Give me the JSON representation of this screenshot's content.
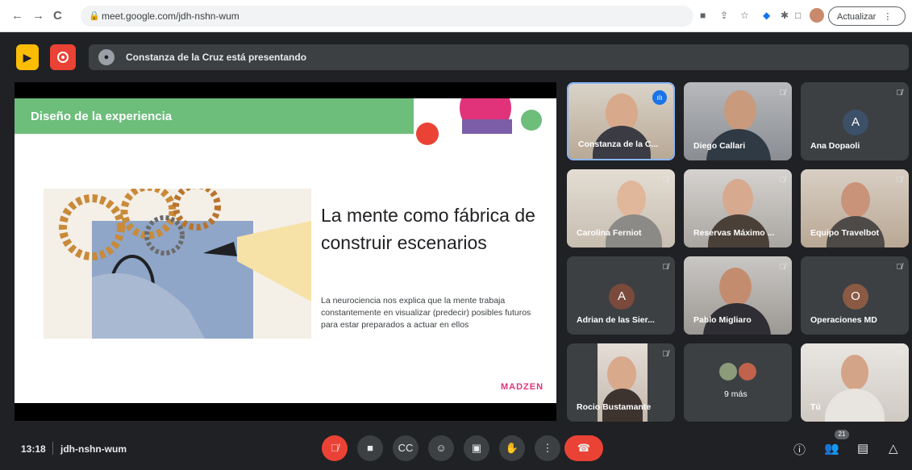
{
  "browser": {
    "back": "←",
    "forward": "→",
    "reload": "C",
    "url": "meet.google.com/jdh-nshn-wum",
    "update_label": "Actualizar",
    "menu": "⋮"
  },
  "meet": {
    "presenting_text": "Constanza de la Cruz está presentando",
    "slide": {
      "banner": "Diseño de la experiencia",
      "heading": "La mente como fábrica de construir escenarios",
      "body": "La neurociencia nos explica que la mente trabaja constantemente en visualizar (predecir) posibles futuros para estar preparados a actuar en ellos",
      "brand": "MADZEN"
    },
    "tiles": [
      {
        "name": "Constanza de la C...",
        "type": "video",
        "speaking": true
      },
      {
        "name": "Diego Callari",
        "type": "video"
      },
      {
        "name": "Ana Dopaoli",
        "type": "avatar",
        "initial": "A",
        "color": "#3c5068"
      },
      {
        "name": "Carolina Ferniot",
        "type": "video"
      },
      {
        "name": "Reservas Máximo ...",
        "type": "video"
      },
      {
        "name": "Equipo Travelbot",
        "type": "video"
      },
      {
        "name": "Adrian de las Sier...",
        "type": "avatar",
        "initial": "A",
        "color": "#7a4a3c"
      },
      {
        "name": "Pablo Migliaro",
        "type": "video"
      },
      {
        "name": "Operaciones MD",
        "type": "avatar",
        "initial": "O",
        "color": "#8a5a44"
      },
      {
        "name": "Rocio Bustamante",
        "type": "video"
      },
      {
        "name": "9 más",
        "type": "more"
      },
      {
        "name": "Tú",
        "type": "video"
      }
    ],
    "time": "13:18",
    "meeting_code": "jdh-nshn-wum",
    "participants_count": "21"
  }
}
